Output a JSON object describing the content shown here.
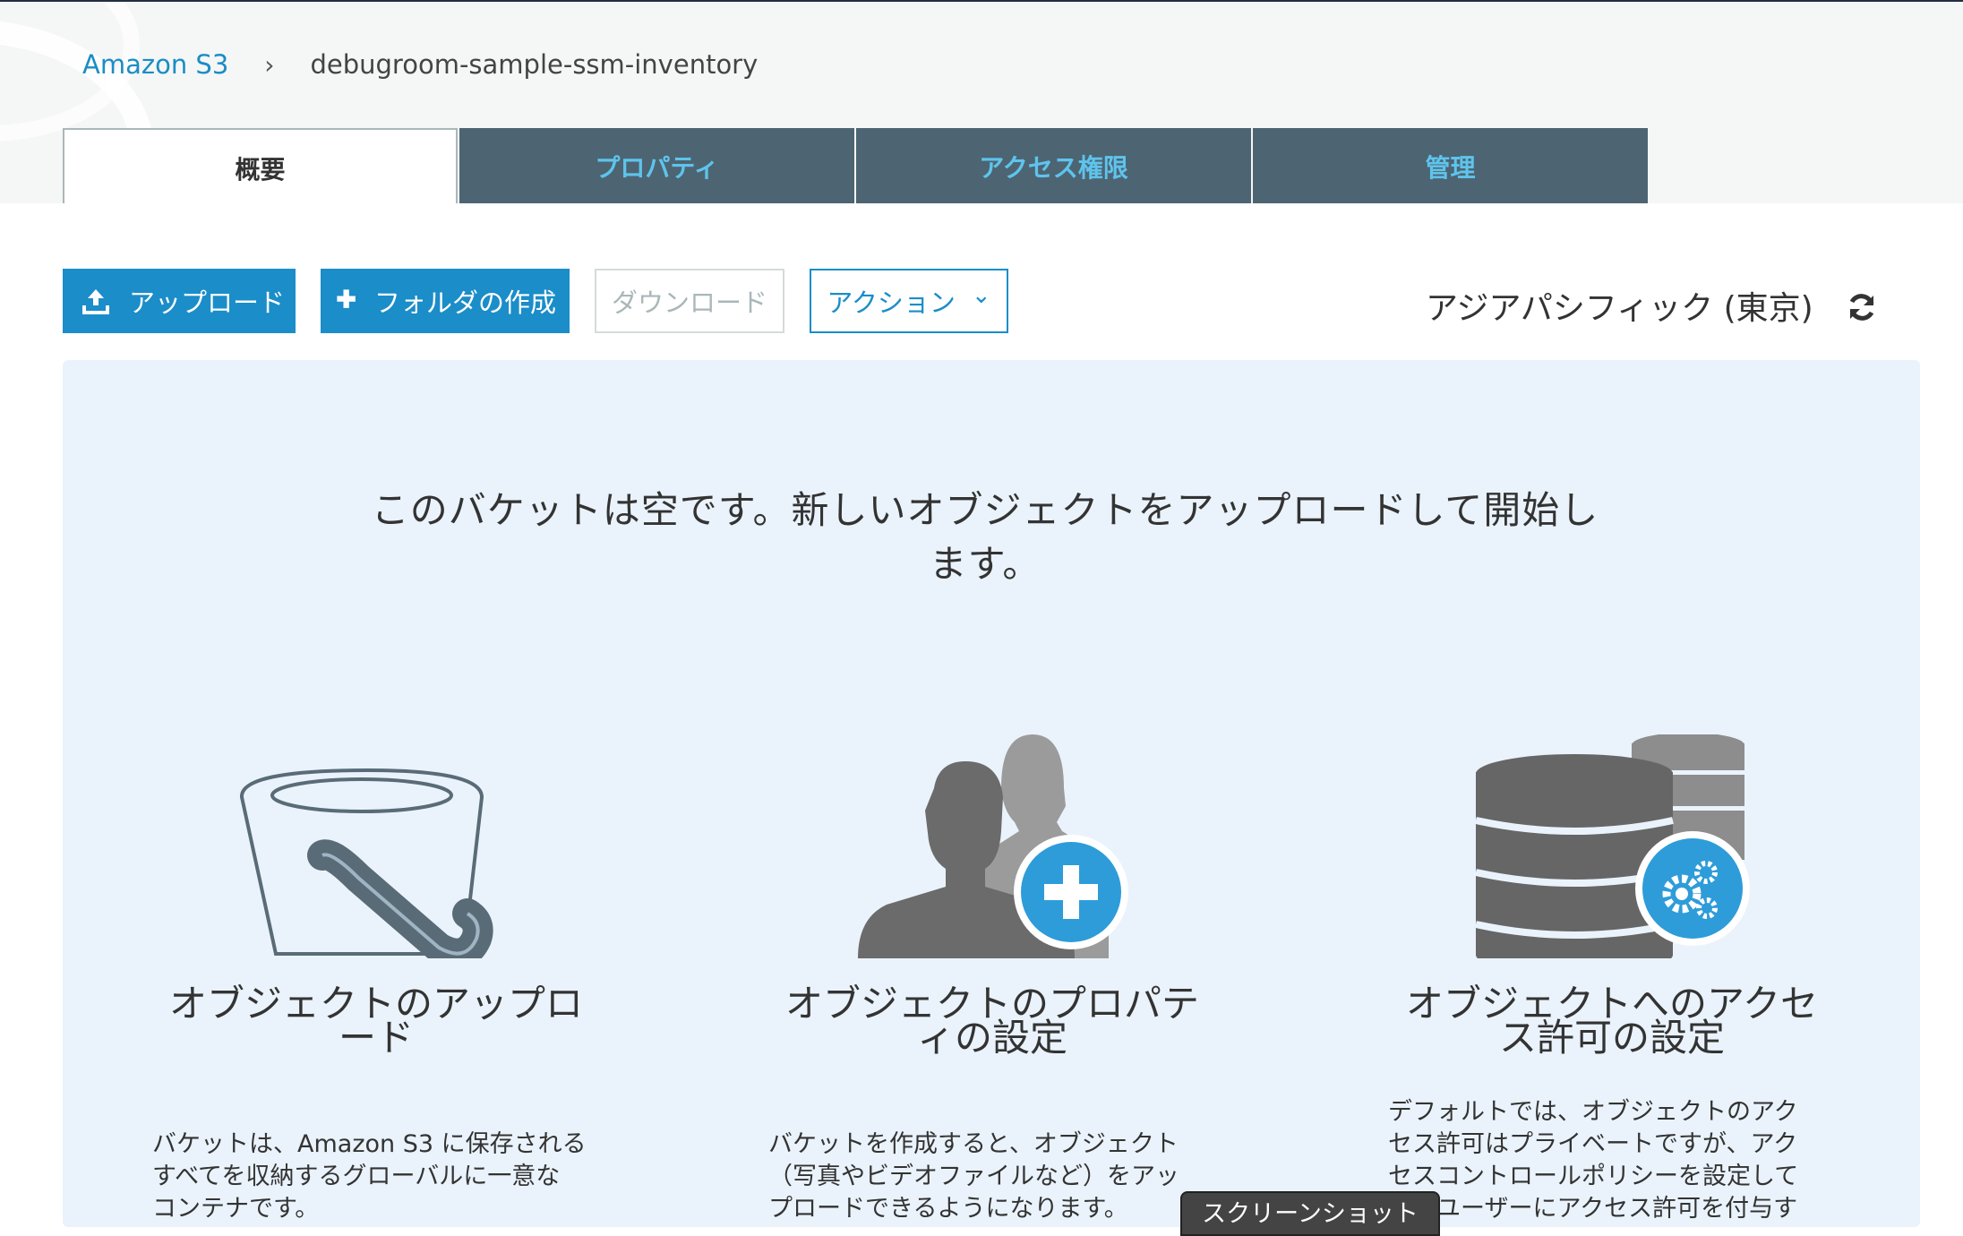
{
  "breadcrumb": {
    "root": "Amazon S3",
    "separator": "›",
    "current": "debugroom-sample-ssm-inventory"
  },
  "tabs": [
    {
      "label": "概要",
      "active": true
    },
    {
      "label": "プロパティ",
      "active": false
    },
    {
      "label": "アクセス権限",
      "active": false
    },
    {
      "label": "管理",
      "active": false
    }
  ],
  "toolbar": {
    "upload_label": "アップロード",
    "create_folder_label": "フォルダの作成",
    "download_label": "ダウンロード",
    "action_label": "アクション",
    "action_chevron": "⌄",
    "region": "アジアパシフィック (東京)"
  },
  "main": {
    "empty_message_line1": "このバケットは空です。新しいオブジェクトをアップロードして開始し",
    "empty_message_line2": "ます。",
    "cards": [
      {
        "icon": "bucket-icon",
        "title_line1": "オブジェクトのアップロ",
        "title_line2": "ード",
        "desc_line1": "バケットは、Amazon S3 に保存される",
        "desc_line2": "すべてを収納するグローバルに一意な",
        "desc_line3": "コンテナです。"
      },
      {
        "icon": "users-add-icon",
        "title_line1": "オブジェクトのプロパテ",
        "title_line2": "ィの設定",
        "desc_line1": "バケットを作成すると、オブジェクト",
        "desc_line2": "（写真やビデオファイルなど）をアッ",
        "desc_line3": "プロードできるようになります。"
      },
      {
        "icon": "database-settings-icon",
        "title_line1": "オブジェクトへのアクセ",
        "title_line2": "ス許可の設定",
        "desc_line1": "デフォルトでは、オブジェクトのアク",
        "desc_line2": "セス許可はプライベートですが、アク",
        "desc_line3": "セスコントロールポリシーを設定して",
        "desc_line4": "他のユーザーにアクセス許可を付与す"
      }
    ]
  },
  "tooltip": "スクリーンショット",
  "colors": {
    "accent": "#1b8dc9",
    "tab_bg": "#4d6473",
    "tab_text": "#5ec4ec",
    "panel_bg": "#eaf3fb"
  }
}
